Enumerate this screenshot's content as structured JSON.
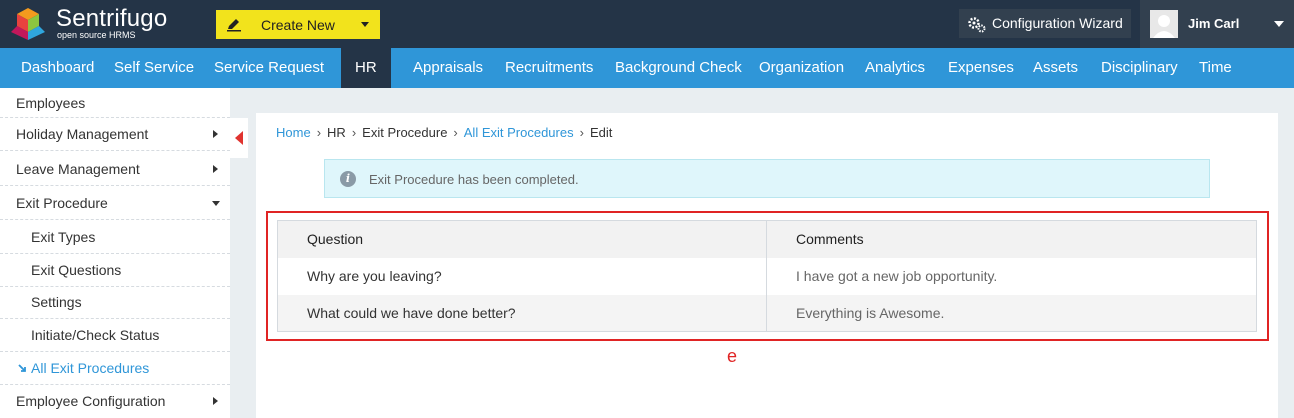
{
  "app": {
    "brand": "Sentrifugo",
    "brand_sub": "open source HRMS",
    "create_new_label": "Create New",
    "config_wizard_label": "Configuration Wizard",
    "user_name": "Jim Carl"
  },
  "nav": {
    "items": [
      "Dashboard",
      "Self Service",
      "Service Request",
      "HR",
      "Appraisals",
      "Recruitments",
      "Background Check",
      "Organization",
      "Analytics",
      "Expenses",
      "Assets",
      "Disciplinary",
      "Time"
    ],
    "active": "HR"
  },
  "sidebar": {
    "items": [
      {
        "label": "Employees",
        "level": "top",
        "arrow": "none"
      },
      {
        "label": "Holiday Management",
        "level": "top",
        "arrow": "right"
      },
      {
        "label": "Leave Management",
        "level": "top",
        "arrow": "right"
      },
      {
        "label": "Exit Procedure",
        "level": "top",
        "arrow": "down"
      },
      {
        "label": "Exit Types",
        "level": "sub",
        "arrow": "none"
      },
      {
        "label": "Exit Questions",
        "level": "sub",
        "arrow": "none"
      },
      {
        "label": "Settings",
        "level": "sub",
        "arrow": "none"
      },
      {
        "label": "Initiate/Check Status",
        "level": "sub",
        "arrow": "none"
      },
      {
        "label": "All Exit Procedures",
        "level": "sub",
        "arrow": "none",
        "active": true
      },
      {
        "label": "Employee Configuration",
        "level": "top",
        "arrow": "right"
      }
    ]
  },
  "breadcrumb": {
    "home": "Home",
    "hr": "HR",
    "exit_procedure": "Exit Procedure",
    "all_exit": "All Exit Procedures",
    "current": "Edit"
  },
  "alert": {
    "icon": "i",
    "message": "Exit Procedure has been completed."
  },
  "table": {
    "headers": [
      "Question",
      "Comments"
    ],
    "rows": [
      [
        "Why are you leaving?",
        "I have got a new job opportunity."
      ],
      [
        "What could we have done better?",
        "Everything is Awesome."
      ]
    ]
  },
  "annotation": {
    "mark": "e",
    "color": "#e02424"
  },
  "colors": {
    "topbar": "#243447",
    "nav": "#2f96d8",
    "create_button": "#f2e31c"
  }
}
